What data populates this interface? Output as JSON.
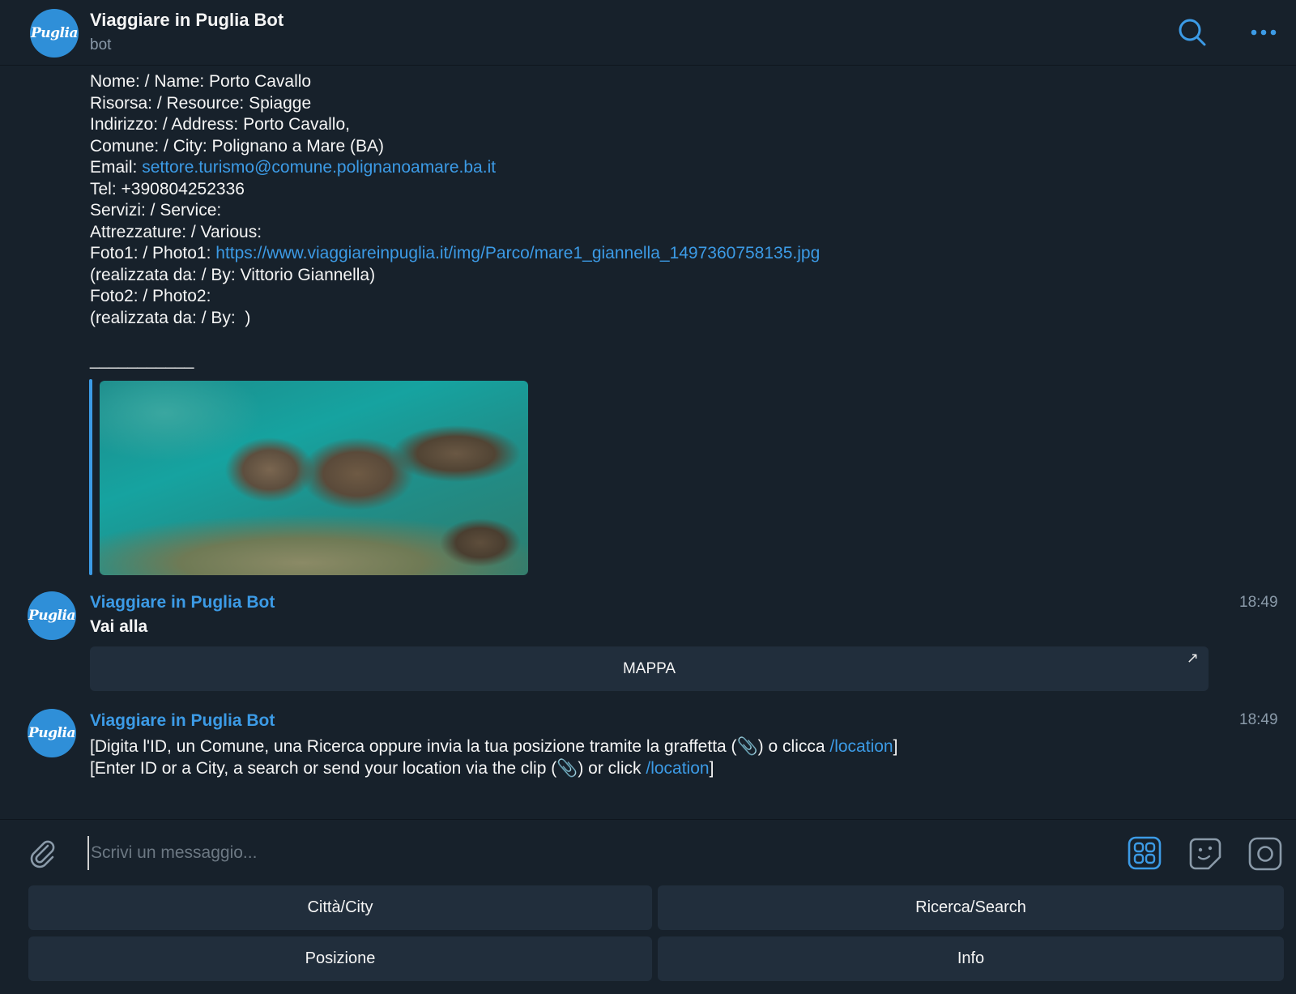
{
  "header": {
    "title": "Viaggiare in Puglia Bot",
    "subtitle": "bot",
    "avatar_text": "Puglia"
  },
  "details": {
    "name_line": "Nome: / Name: Porto Cavallo",
    "resource_line": "Risorsa: / Resource: Spiagge",
    "address_line": "Indirizzo: / Address: Porto Cavallo,",
    "city_line": "Comune: / City: Polignano a Mare (BA)",
    "email_label": "Email: ",
    "email_value": "settore.turismo@comune.polignanoamare.ba.it",
    "tel_line": "Tel: +390804252336",
    "services_line": "Servizi: / Service:",
    "various_line": "Attrezzature: / Various:",
    "photo1_label": "Foto1: / Photo1: ",
    "photo1_url": "https://www.viaggiareinpuglia.it/img/Parco/mare1_giannella_1497360758135.jpg",
    "photo1_credit": "(realizzata da: / By: Vittorio Giannella)",
    "photo2_label": "Foto2: / Photo2:",
    "photo2_credit": "(realizzata da: / By:  )",
    "separator": "___________"
  },
  "messages": [
    {
      "sender": "Viaggiare in Puglia Bot",
      "time": "18:49",
      "text": "Vai alla",
      "button_label": "MAPPA",
      "button_icon": "↗"
    },
    {
      "sender": "Viaggiare in Puglia Bot",
      "time": "18:49",
      "line1_prefix": "[Digita l'ID, un Comune, una Ricerca oppure invia la tua posizione tramite la graffetta (📎) o clicca ",
      "line1_link": "/location",
      "line1_suffix": "]",
      "line2_prefix": "[Enter ID or a City, a search or send your location via the clip (📎) or click ",
      "line2_link": "/location",
      "line2_suffix": "]"
    }
  ],
  "composer": {
    "placeholder": "Scrivi un messaggio..."
  },
  "reply_keyboard": [
    "Città/City",
    "Ricerca/Search",
    "Posizione",
    "Info"
  ],
  "colors": {
    "background": "#17212b",
    "accent": "#3c9be6",
    "button": "#212e3c",
    "muted": "#8a9aa9"
  }
}
